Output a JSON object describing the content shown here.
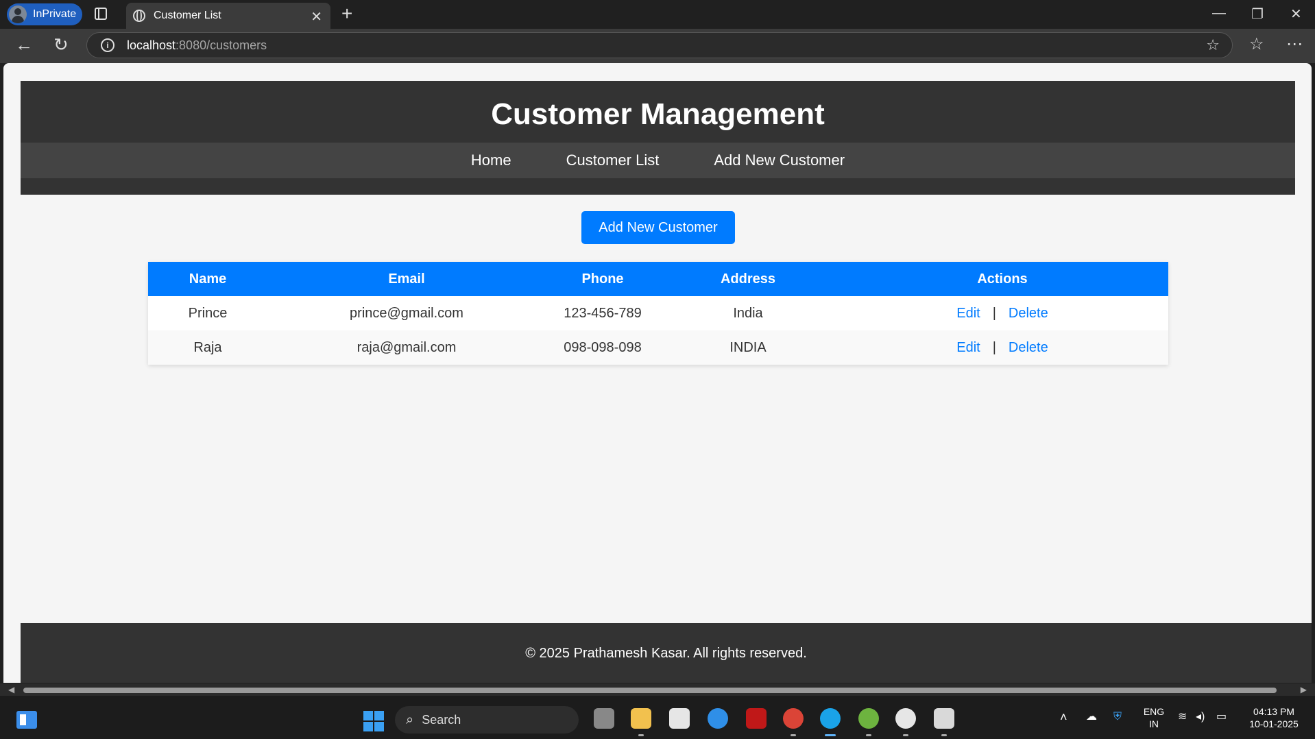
{
  "browser": {
    "profile_label": "InPrivate",
    "tab_title": "Customer List",
    "url_host": "localhost",
    "url_path": ":8080/customers"
  },
  "page": {
    "title": "Customer Management",
    "nav": [
      "Home",
      "Customer List",
      "Add New Customer"
    ],
    "add_button": "Add New Customer",
    "table": {
      "headers": [
        "Name",
        "Email",
        "Phone",
        "Address",
        "Actions"
      ],
      "rows": [
        {
          "name": "Prince",
          "email": "prince@gmail.com",
          "phone": "123-456-789",
          "address": "India",
          "edit": "Edit",
          "sep": "|",
          "delete": "Delete"
        },
        {
          "name": "Raja",
          "email": "raja@gmail.com",
          "phone": "098-098-098",
          "address": "INDIA",
          "edit": "Edit",
          "sep": "|",
          "delete": "Delete"
        }
      ]
    },
    "footer": "© 2025 Prathamesh Kasar. All rights reserved."
  },
  "taskbar": {
    "search_label": "Search",
    "lang_top": "ENG",
    "lang_bottom": "IN",
    "time": "04:13 PM",
    "date": "10-01-2025"
  },
  "colors": {
    "primary": "#007bff",
    "header_bg": "#333333",
    "nav_bg": "#444444"
  },
  "icons": {
    "taskbar": [
      "widgets-icon",
      "windows-start-icon",
      "task-view-icon",
      "file-explorer-icon",
      "microsoft-store-icon",
      "help-icon",
      "mcafee-icon",
      "chrome-icon",
      "edge-icon",
      "spring-tools-icon",
      "github-icon",
      "snipping-tool-icon"
    ]
  }
}
